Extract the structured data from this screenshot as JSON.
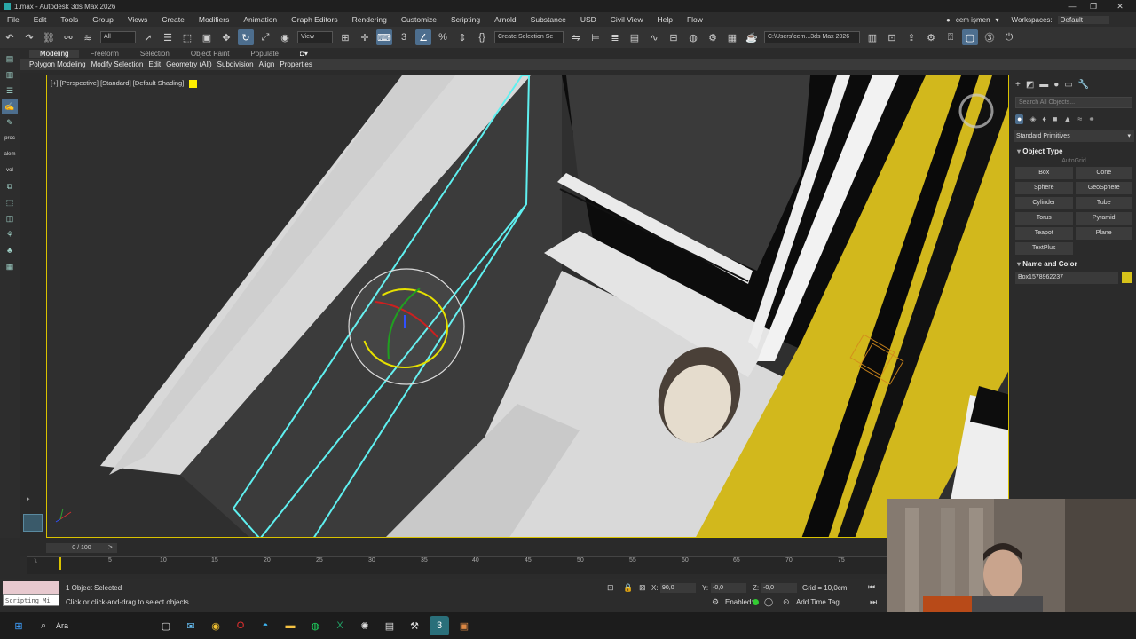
{
  "window": {
    "title": "1.max - Autodesk 3ds Max 2026",
    "controls": [
      "—",
      "❐",
      "✕"
    ]
  },
  "menu": {
    "items": [
      "File",
      "Edit",
      "Tools",
      "Group",
      "Views",
      "Create",
      "Modifiers",
      "Animation",
      "Graph Editors",
      "Rendering",
      "Customize",
      "Scripting",
      "Arnold",
      "Substance",
      "USD",
      "Civil View",
      "Help",
      "Flow"
    ],
    "user": "cem işmen",
    "workspace_label": "Workspaces:",
    "workspace_value": "Default"
  },
  "toolbar": {
    "selection_filter": "All",
    "ref_coord": "View",
    "named_selection": "Create Selection Se",
    "path": "C:\\Users\\cem...3ds Max 2026"
  },
  "ribbon": {
    "tabs": [
      "Modeling",
      "Freeform",
      "Selection",
      "Object Paint",
      "Populate"
    ],
    "items": [
      "Polygon Modeling",
      "Modify Selection",
      "Edit",
      "Geometry (All)",
      "Subdivision",
      "Align",
      "Properties"
    ]
  },
  "left_tools": {
    "labels": [
      "proc",
      "alem",
      "vol"
    ]
  },
  "viewport": {
    "label": "[+] [Perspective] [Standard] [Default Shading]"
  },
  "command_panel": {
    "search_placeholder": "Search All Objects...",
    "category": "Standard Primitives",
    "object_type_title": "Object Type",
    "autogrid": "AutoGrid",
    "buttons": [
      "Box",
      "Cone",
      "Sphere",
      "GeoSphere",
      "Cylinder",
      "Tube",
      "Torus",
      "Pyramid",
      "Teapot",
      "Plane",
      "TextPlus"
    ],
    "name_color_title": "Name and Color",
    "object_name": "Box1578962237",
    "object_color": "#d6c21a"
  },
  "timeline": {
    "frame_label": "0 / 100",
    "ticks": [
      "5",
      "10",
      "15",
      "20",
      "25",
      "30",
      "35",
      "40",
      "45",
      "50",
      "55",
      "60",
      "65",
      "70",
      "75"
    ]
  },
  "status": {
    "selected": "1 Object Selected",
    "prompt": "Click or click-and-drag to select objects",
    "mini_listener": "Scripting Mi",
    "x_label": "X:",
    "x_value": "90,0",
    "y_label": "Y:",
    "y_value": "-0,0",
    "z_label": "Z:",
    "z_value": "-0,0",
    "grid": "Grid = 10,0cm",
    "enabled_label": "Enabled:",
    "add_time_tag": "Add Time Tag"
  },
  "taskbar": {
    "search": "Ara"
  },
  "colors": {
    "accent": "#d9c200",
    "selection": "#5ff0f0",
    "active_button": "#4d6e8e"
  }
}
